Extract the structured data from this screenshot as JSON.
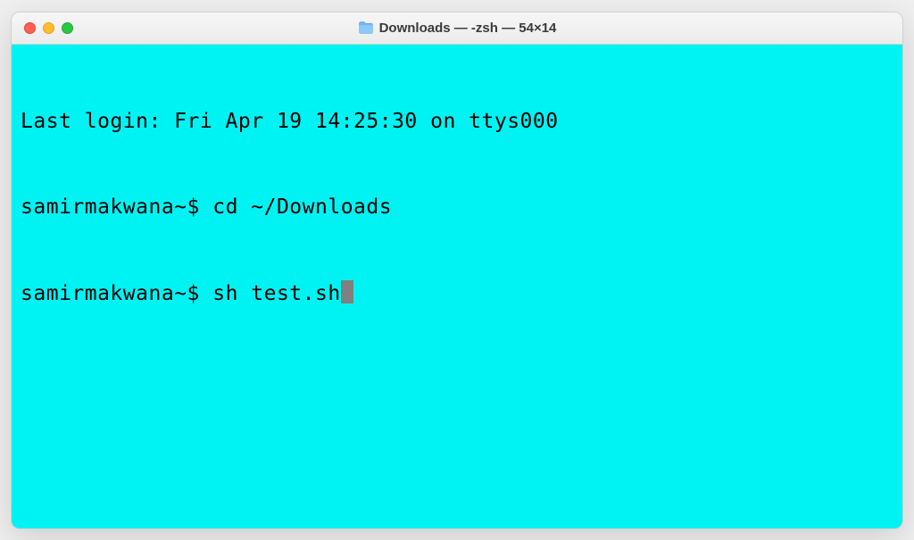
{
  "window": {
    "title": "Downloads — -zsh — 54×14"
  },
  "terminal": {
    "lines": [
      {
        "text": "Last login: Fri Apr 19 14:25:30 on ttys000"
      },
      {
        "prompt": "samirmakwana~$ ",
        "command": "cd ~/Downloads"
      },
      {
        "prompt": "samirmakwana~$ ",
        "command": "sh test.sh",
        "cursor": true
      }
    ]
  }
}
